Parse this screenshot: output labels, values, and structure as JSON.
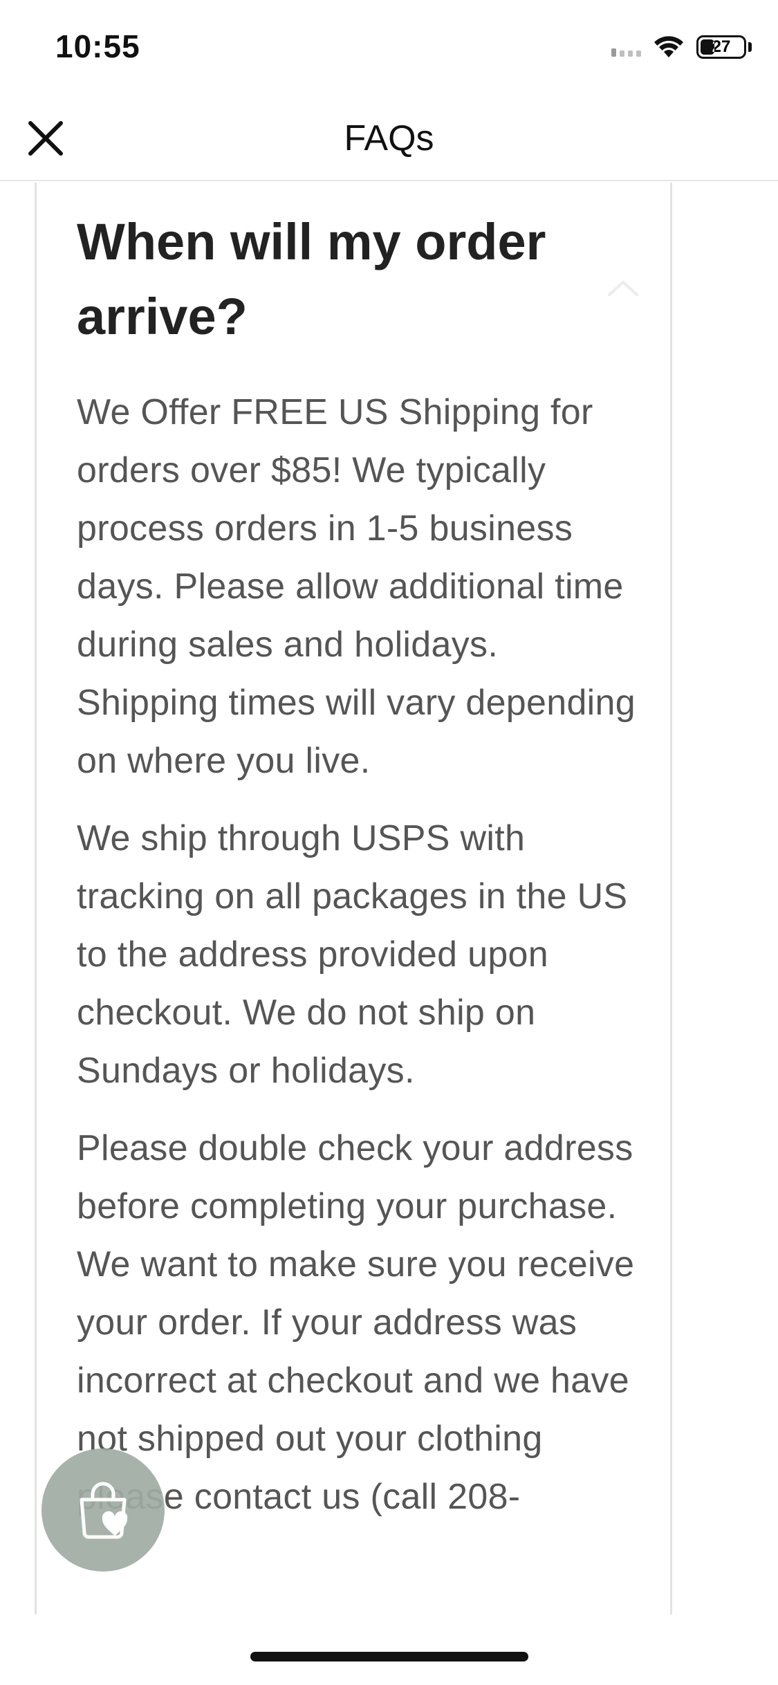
{
  "status_bar": {
    "time": "10:55",
    "battery_level": "27",
    "icons": [
      "signal-icon",
      "wifi-icon",
      "battery-icon"
    ]
  },
  "header": {
    "title": "FAQs",
    "close_icon": "close-icon"
  },
  "faq": {
    "question": "When will my order arrive?",
    "expanded": true,
    "answer_paragraphs": [
      "We Offer FREE US Shipping for orders over $85! We typically process orders in 1-5 business days. Please allow additional time during sales and holidays. Shipping times will vary depending on where you live.",
      "We ship through USPS with tracking on all packages in the US to the address provided upon checkout. We do not ship on Sundays or holidays.",
      "Please double check your address before completing your purchase. We want to make sure you receive your order. If your address was incorrect at checkout and we have not shipped out your clothing please contact us (call 208-"
    ]
  },
  "floating_button": {
    "icon": "shopping-bag-heart-icon"
  },
  "colors": {
    "bag_button_bg": "#a0aca3",
    "card_border": "#e2e2e2",
    "answer_text": "#555555"
  }
}
